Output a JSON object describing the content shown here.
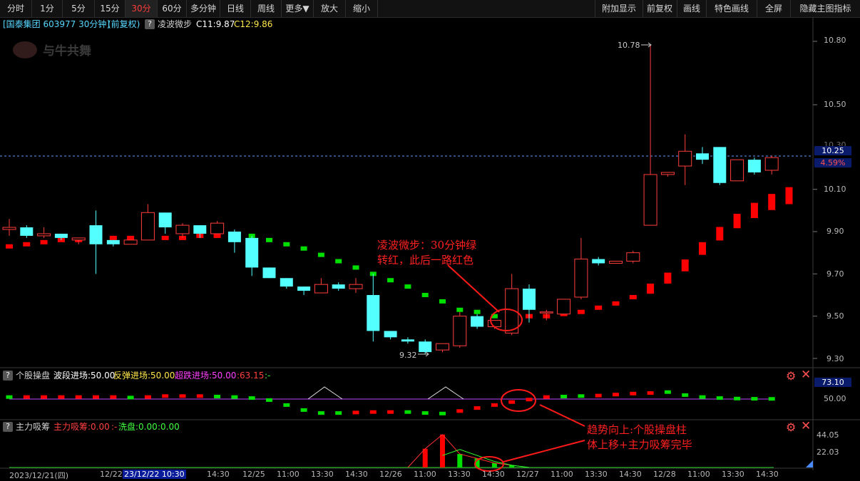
{
  "toolbar": {
    "left": [
      "分时",
      "1分",
      "5分",
      "15分",
      "30分",
      "60分",
      "多分钟",
      "日线",
      "周线",
      "更多▼",
      "放大",
      "缩小"
    ],
    "active": "30分",
    "right": [
      "附加显示",
      "前复权",
      "画线",
      "特色画线",
      "全屏",
      "隐藏主图指标"
    ]
  },
  "main_header": {
    "stock": "[国泰集团 603977 30分钟]",
    "adjust": "(前复权)",
    "indicator": "凌波微步",
    "c11": "C11:9.87",
    "c12": "C12:9.86"
  },
  "watermark": "与牛共舞",
  "price_axis": {
    "ticks": [
      "10.80",
      "10.50",
      "10.30",
      "10.10",
      "9.90",
      "9.70",
      "9.50",
      "9.30"
    ],
    "current": "10.25",
    "pct": "4.59%"
  },
  "markers": {
    "high": "10.78",
    "low": "9.32"
  },
  "annotation1": {
    "line1": "凌波微步：30分钟绿",
    "line2": "转红，此后一路红色"
  },
  "annotation2": {
    "line1": "趋势向上:个股操盘柱",
    "line2": "体上移+主力吸筹完毕"
  },
  "panel2": {
    "name": "个股操盘",
    "v1": "波段进场:50.00",
    "v2": "反弹进场:50.00",
    "v3": "超跌进场:50.00",
    "v4": ":63.15",
    "v5": ":-",
    "axis_top": "73.10",
    "axis_mid": "50.00"
  },
  "panel3": {
    "name": "主力吸筹",
    "v1": "主力吸筹:0.00",
    "v2": ":-",
    "v3": "洗盘:0.00",
    "v4": ":0.00",
    "axis_top": "44.05",
    "axis_mid": "22.03"
  },
  "time_axis": [
    "2023/12/21(四)",
    "12/22",
    "23/12/22 10:30",
    "14:30",
    "12/25",
    "11:00",
    "13:30",
    "14:30",
    "12/26",
    "11:00",
    "13:30",
    "14:30",
    "12/27",
    "11:00",
    "13:30",
    "14:30",
    "12/28",
    "11:00",
    "13:30",
    "14:30"
  ],
  "colors": {
    "up": "#ff3c3c",
    "down": "#54ffff",
    "signal_red": "#ff0000",
    "signal_green": "#00e000",
    "bg": "#000000",
    "grid": "#2a2a2a"
  },
  "icons": {
    "question": "?",
    "settings": "gear-icon",
    "close": "close-icon"
  },
  "chart_data": {
    "type": "candlestick",
    "candles": [
      {
        "o": 9.91,
        "c": 9.92,
        "h": 9.96,
        "l": 9.88
      },
      {
        "o": 9.92,
        "c": 9.88,
        "h": 9.93,
        "l": 9.87
      },
      {
        "o": 9.88,
        "c": 9.89,
        "h": 9.92,
        "l": 9.87
      },
      {
        "o": 9.89,
        "c": 9.87,
        "h": 9.89,
        "l": 9.86
      },
      {
        "o": 9.86,
        "c": 9.87,
        "h": 9.87,
        "l": 9.84
      },
      {
        "o": 9.93,
        "c": 9.84,
        "h": 10.0,
        "l": 9.7
      },
      {
        "o": 9.86,
        "c": 9.84,
        "h": 9.86,
        "l": 9.83
      },
      {
        "o": 9.84,
        "c": 9.86,
        "h": 9.86,
        "l": 9.84
      },
      {
        "o": 9.86,
        "c": 9.99,
        "h": 10.03,
        "l": 9.86
      },
      {
        "o": 9.99,
        "c": 9.92,
        "h": 9.99,
        "l": 9.89
      },
      {
        "o": 9.89,
        "c": 9.93,
        "h": 9.94,
        "l": 9.87
      },
      {
        "o": 9.93,
        "c": 9.89,
        "h": 9.93,
        "l": 9.87
      },
      {
        "o": 9.89,
        "c": 9.94,
        "h": 9.95,
        "l": 9.89
      },
      {
        "o": 9.9,
        "c": 9.85,
        "h": 9.91,
        "l": 9.8
      },
      {
        "o": 9.87,
        "c": 9.73,
        "h": 9.88,
        "l": 9.69
      },
      {
        "o": 9.73,
        "c": 9.68,
        "h": 9.73,
        "l": 9.68
      },
      {
        "o": 9.68,
        "c": 9.64,
        "h": 9.68,
        "l": 9.63
      },
      {
        "o": 9.64,
        "c": 9.62,
        "h": 9.64,
        "l": 9.6
      },
      {
        "o": 9.61,
        "c": 9.65,
        "h": 9.68,
        "l": 9.61
      },
      {
        "o": 9.65,
        "c": 9.63,
        "h": 9.66,
        "l": 9.62
      },
      {
        "o": 9.63,
        "c": 9.65,
        "h": 9.68,
        "l": 9.61
      },
      {
        "o": 9.6,
        "c": 9.43,
        "h": 9.7,
        "l": 9.38
      },
      {
        "o": 9.43,
        "c": 9.4,
        "h": 9.43,
        "l": 9.39
      },
      {
        "o": 9.39,
        "c": 9.38,
        "h": 9.4,
        "l": 9.37
      },
      {
        "o": 9.38,
        "c": 9.33,
        "h": 9.39,
        "l": 9.32
      },
      {
        "o": 9.34,
        "c": 9.37,
        "h": 9.37,
        "l": 9.33
      },
      {
        "o": 9.36,
        "c": 9.5,
        "h": 9.52,
        "l": 9.35
      },
      {
        "o": 9.5,
        "c": 9.45,
        "h": 9.51,
        "l": 9.44
      },
      {
        "o": 9.45,
        "c": 9.48,
        "h": 9.48,
        "l": 9.44
      },
      {
        "o": 9.42,
        "c": 9.63,
        "h": 9.7,
        "l": 9.41
      },
      {
        "o": 9.63,
        "c": 9.53,
        "h": 9.65,
        "l": 9.47
      },
      {
        "o": 9.52,
        "c": 9.52,
        "h": 9.53,
        "l": 9.48
      },
      {
        "o": 9.51,
        "c": 9.58,
        "h": 9.58,
        "l": 9.51
      },
      {
        "o": 9.59,
        "c": 9.77,
        "h": 9.87,
        "l": 9.58
      },
      {
        "o": 9.77,
        "c": 9.75,
        "h": 9.78,
        "l": 9.74
      },
      {
        "o": 9.75,
        "c": 9.76,
        "h": 9.76,
        "l": 9.75
      },
      {
        "o": 9.76,
        "c": 9.8,
        "h": 9.81,
        "l": 9.75
      },
      {
        "o": 9.93,
        "c": 10.17,
        "h": 10.78,
        "l": 9.93
      },
      {
        "o": 10.17,
        "c": 10.18,
        "h": 10.18,
        "l": 10.16
      },
      {
        "o": 10.21,
        "c": 10.28,
        "h": 10.36,
        "l": 10.12
      },
      {
        "o": 10.27,
        "c": 10.24,
        "h": 10.3,
        "l": 10.22
      },
      {
        "o": 10.3,
        "c": 10.13,
        "h": 10.3,
        "l": 10.12
      },
      {
        "o": 10.14,
        "c": 10.24,
        "h": 10.24,
        "l": 10.14
      },
      {
        "o": 10.24,
        "c": 10.18,
        "h": 10.25,
        "l": 10.17
      },
      {
        "o": 10.19,
        "c": 10.25,
        "h": 10.26,
        "l": 10.17
      }
    ],
    "signal": [
      {
        "v": 9.83,
        "c": "r"
      },
      {
        "v": 9.84,
        "c": "r"
      },
      {
        "v": 9.85,
        "c": "r"
      },
      {
        "v": 9.86,
        "c": "r"
      },
      {
        "v": 9.86,
        "c": "r"
      },
      {
        "v": 9.87,
        "c": "r"
      },
      {
        "v": 9.87,
        "c": "r"
      },
      {
        "v": 9.87,
        "c": "r"
      },
      {
        "v": 9.87,
        "c": "r"
      },
      {
        "v": 9.87,
        "c": "r"
      },
      {
        "v": 9.87,
        "c": "r"
      },
      {
        "v": 9.88,
        "c": "r"
      },
      {
        "v": 9.88,
        "c": "r"
      },
      {
        "v": 9.88,
        "c": "r"
      },
      {
        "v": 9.88,
        "c": "g"
      },
      {
        "v": 9.86,
        "c": "g"
      },
      {
        "v": 9.84,
        "c": "g"
      },
      {
        "v": 9.82,
        "c": "g"
      },
      {
        "v": 9.79,
        "c": "g"
      },
      {
        "v": 9.76,
        "c": "g"
      },
      {
        "v": 9.73,
        "c": "g"
      },
      {
        "v": 9.7,
        "c": "g"
      },
      {
        "v": 9.67,
        "c": "g"
      },
      {
        "v": 9.64,
        "c": "g"
      },
      {
        "v": 9.6,
        "c": "g"
      },
      {
        "v": 9.57,
        "c": "g"
      },
      {
        "v": 9.53,
        "c": "g"
      },
      {
        "v": 9.52,
        "c": "g"
      },
      {
        "v": 9.5,
        "c": "g"
      },
      {
        "v": 9.5,
        "c": "r"
      },
      {
        "v": 9.5,
        "c": "r"
      },
      {
        "v": 9.5,
        "c": "r"
      },
      {
        "v": 9.51,
        "c": "r"
      },
      {
        "v": 9.52,
        "c": "r"
      },
      {
        "v": 9.54,
        "c": "r"
      },
      {
        "v": 9.56,
        "c": "r"
      },
      {
        "v": 9.59,
        "c": "r"
      },
      {
        "v": 9.63,
        "c": "r"
      },
      {
        "v": 9.68,
        "c": "r"
      },
      {
        "v": 9.74,
        "c": "r"
      },
      {
        "v": 9.82,
        "c": "r"
      },
      {
        "v": 9.89,
        "c": "r"
      },
      {
        "v": 9.95,
        "c": "r"
      },
      {
        "v": 10.0,
        "c": "r"
      },
      {
        "v": 10.04,
        "c": "r"
      },
      {
        "v": 10.07,
        "c": "r"
      }
    ],
    "panel2_bars": [
      {
        "v": 52,
        "c": "g"
      },
      {
        "v": 52,
        "c": "r"
      },
      {
        "v": 52,
        "c": "r"
      },
      {
        "v": 52,
        "c": "r"
      },
      {
        "v": 52,
        "c": "r"
      },
      {
        "v": 52,
        "c": "r"
      },
      {
        "v": 52,
        "c": "r"
      },
      {
        "v": 51.5,
        "c": "g"
      },
      {
        "v": 52,
        "c": "r"
      },
      {
        "v": 53,
        "c": "r"
      },
      {
        "v": 53,
        "c": "r"
      },
      {
        "v": 53,
        "c": "r"
      },
      {
        "v": 52.5,
        "c": "g"
      },
      {
        "v": 52,
        "c": "g"
      },
      {
        "v": 51,
        "c": "g"
      },
      {
        "v": 49,
        "c": "g"
      },
      {
        "v": 44,
        "c": "g"
      },
      {
        "v": 39,
        "c": "g"
      },
      {
        "v": 36,
        "c": "g"
      },
      {
        "v": 36,
        "c": "g"
      },
      {
        "v": 36.5,
        "c": "r"
      },
      {
        "v": 37,
        "c": "r"
      },
      {
        "v": 37,
        "c": "r"
      },
      {
        "v": 37,
        "c": "g"
      },
      {
        "v": 36,
        "c": "g"
      },
      {
        "v": 35.5,
        "c": "g"
      },
      {
        "v": 38,
        "c": "r"
      },
      {
        "v": 41,
        "c": "r"
      },
      {
        "v": 44,
        "c": "r"
      },
      {
        "v": 47,
        "c": "r"
      },
      {
        "v": 49.5,
        "c": "r"
      },
      {
        "v": 52,
        "c": "r"
      },
      {
        "v": 52.5,
        "c": "g"
      },
      {
        "v": 53,
        "c": "g"
      },
      {
        "v": 53.5,
        "c": "r"
      },
      {
        "v": 54.5,
        "c": "r"
      },
      {
        "v": 55.5,
        "c": "r"
      },
      {
        "v": 56,
        "c": "r"
      },
      {
        "v": 57,
        "c": "g"
      },
      {
        "v": 54,
        "c": "g"
      },
      {
        "v": 52,
        "c": "g"
      },
      {
        "v": 51,
        "c": "g"
      },
      {
        "v": 50.5,
        "c": "g"
      },
      {
        "v": 50.3,
        "c": "g"
      },
      {
        "v": 50.2,
        "c": "g"
      }
    ],
    "panel3_bars": [
      {
        "i": 24,
        "v": 25,
        "c": "r"
      },
      {
        "i": 25,
        "v": 44,
        "c": "r"
      },
      {
        "i": 26,
        "v": 18,
        "c": "g"
      },
      {
        "i": 27,
        "v": 12,
        "c": "g"
      },
      {
        "i": 28,
        "v": 6,
        "c": "g"
      },
      {
        "i": 29,
        "v": 3,
        "c": "g"
      }
    ]
  }
}
